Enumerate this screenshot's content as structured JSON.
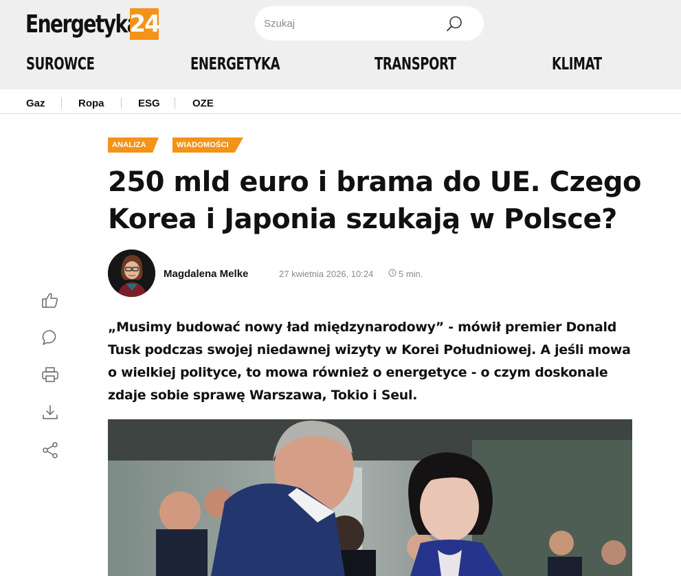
{
  "header": {
    "logo_text": "Energetyka",
    "logo_number": "24",
    "search_placeholder": "Szukaj",
    "nav": [
      "SUROWCE",
      "ENERGETYKA",
      "TRANSPORT",
      "KLIMAT"
    ]
  },
  "sub_nav": [
    "Gaz",
    "Ropa",
    "ESG",
    "OZE"
  ],
  "article": {
    "tags": [
      "ANALIZA",
      "WIADOMOŚCI"
    ],
    "title": "250 mld euro i brama do UE. Czego Korea i Japonia szukają w Polsce?",
    "author": "Magdalena Melke",
    "date": "27 kwietnia 2026, 10:24",
    "read_time": "5 min.",
    "lead": "„Musimy budować nowy ład międzynarodowy” - mówił premier Donald Tusk podczas swojej niedawnej wizyty w Korei Południowej. A jeśli mowa o wielkiej polityce, to mowa również o energetyce - o czym doskonale zdaje sobie sprawę Warszawa, Tokio i Seul."
  },
  "side_actions": [
    "like-icon",
    "comment-icon",
    "print-icon",
    "download-icon",
    "share-icon"
  ],
  "colors": {
    "accent": "#f39317",
    "header_bg": "#efefef",
    "text": "#111111",
    "muted": "#8a8a8a"
  }
}
